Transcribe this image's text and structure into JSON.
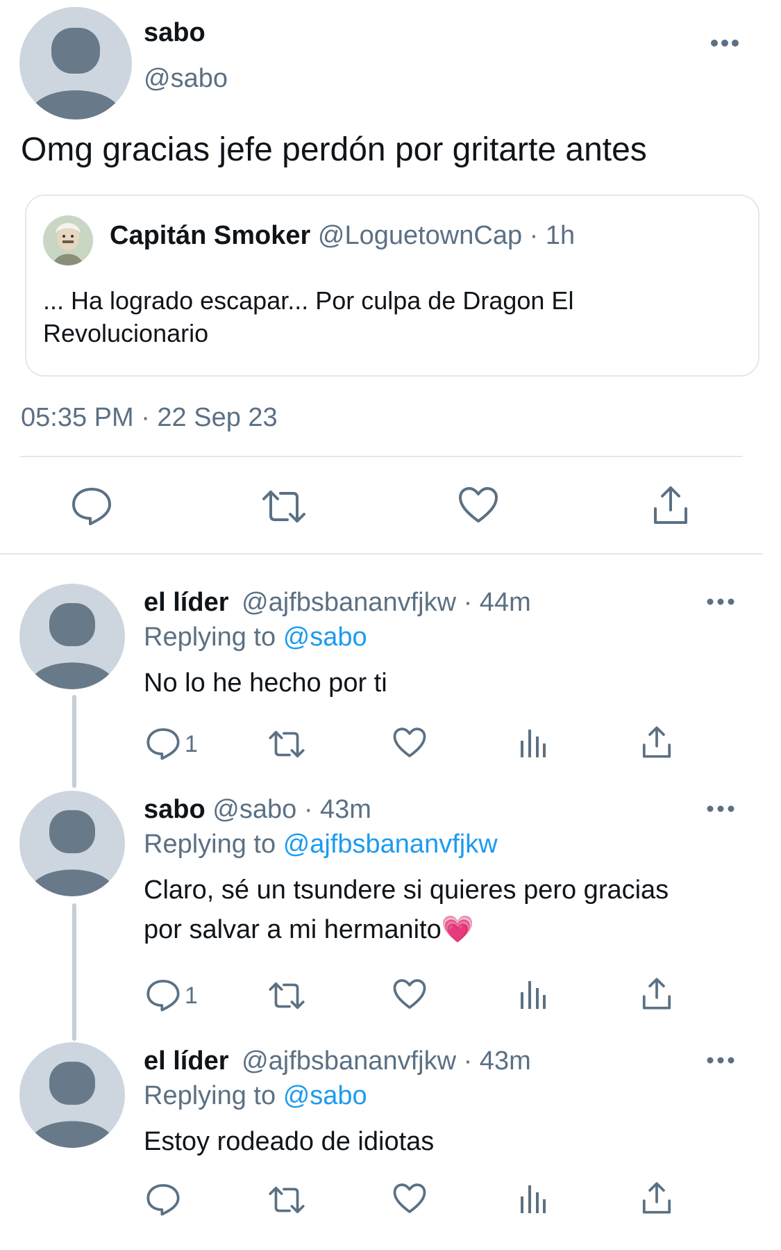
{
  "main_tweet": {
    "display_name": "sabo",
    "handle": "@sabo",
    "text": "Omg gracias jefe perdón por gritarte antes",
    "timestamp": "05:35 PM · 22 Sep 23",
    "quoted": {
      "display_name": "Capitán Smoker",
      "handle": "@LoguetownCap",
      "time": "· 1h",
      "text_line1": "... Ha logrado escapar... Por culpa de Dragon El",
      "text_line2": "Revolucionario"
    }
  },
  "replies": [
    {
      "display_name": "el líder",
      "handle": "@ajfbsbananvfjkw",
      "time": "· 44m",
      "replying_label": "Replying to",
      "replying_to": "@sabo",
      "text_line1": "No lo he hecho por ti",
      "text_line2": "",
      "reply_count": "1"
    },
    {
      "display_name": "sabo",
      "handle": "@sabo",
      "time": "· 43m",
      "replying_label": "Replying to",
      "replying_to": "@ajfbsbananvfjkw",
      "text_line1": "Claro, sé un tsundere si quieres pero gracias",
      "text_line2": "por salvar a mi hermanito💗",
      "reply_count": "1"
    },
    {
      "display_name": "el líder",
      "handle": "@ajfbsbananvfjkw",
      "time": "· 43m",
      "replying_label": "Replying to",
      "replying_to": "@sabo",
      "text_line1": "Estoy rodeado de idiotas",
      "text_line2": "",
      "reply_count": ""
    }
  ],
  "icons": {
    "reply": "speech-bubble-icon",
    "retweet": "retweet-icon",
    "like": "heart-icon",
    "views": "bar-chart-icon",
    "share": "share-upload-icon",
    "more": "ellipsis-icon"
  },
  "colors": {
    "text": "#0f1419",
    "muted": "#5b7083",
    "link": "#1d9bf0",
    "avatar_bg": "#cdd6de",
    "avatar_fg": "#687a8a",
    "divider": "#e1e8ed"
  }
}
